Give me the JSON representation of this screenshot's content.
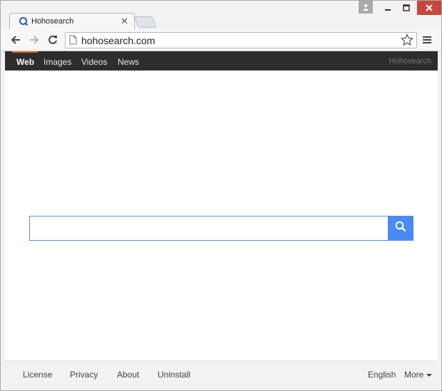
{
  "tab": {
    "title": "Hohosearch",
    "close_glyph": "✕"
  },
  "window_controls": {
    "user_icon": "user-icon",
    "minimize_icon": "minimize-icon",
    "maximize_icon": "maximize-icon",
    "close_icon": "close-icon"
  },
  "toolbar": {
    "back_icon": "back-arrow-icon",
    "forward_icon": "forward-arrow-icon",
    "reload_icon": "reload-icon",
    "url": "hohosearch.com",
    "menu_icon": "hamburger-menu-icon"
  },
  "site_nav": {
    "links": [
      "Web",
      "Images",
      "Videos",
      "News"
    ],
    "active": "Web",
    "brand": "Hohosearch"
  },
  "search": {
    "value": "",
    "placeholder": "",
    "button_icon": "search-icon"
  },
  "footer": {
    "left_links": [
      "License",
      "Privacy",
      "About",
      "Uninstall"
    ],
    "language": "English",
    "more": "More"
  },
  "colors": {
    "accent": "#e06b26",
    "nav_bg": "#2d2d2d",
    "search_button": "#4a8af4",
    "close_button": "#c7463a"
  }
}
